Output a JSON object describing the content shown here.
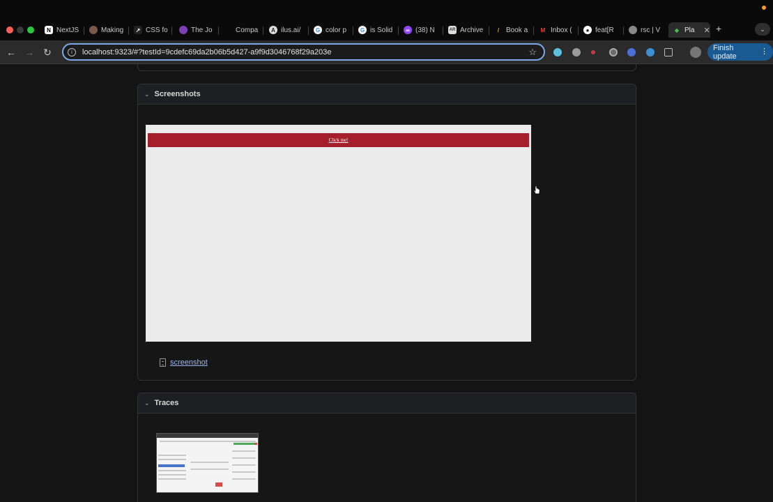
{
  "browser": {
    "tabs": [
      {
        "label": "NextJS",
        "icon": "notion-icon"
      },
      {
        "label": "Making",
        "icon": "avatar-icon"
      },
      {
        "label": "CSS fo",
        "icon": "arrow-icon"
      },
      {
        "label": "The Jo",
        "icon": "circle-icon"
      },
      {
        "label": "Compa",
        "icon": "blank-icon"
      },
      {
        "label": "ilus.ai/",
        "icon": "ilus-icon"
      },
      {
        "label": "color p",
        "icon": "google-icon"
      },
      {
        "label": "is Solid",
        "icon": "google-icon"
      },
      {
        "label": "(38) N",
        "icon": "twitch-icon"
      },
      {
        "label": "Archive",
        "icon": "archive-icon"
      },
      {
        "label": "Book a",
        "icon": "pen-icon"
      },
      {
        "label": "Inbox (",
        "icon": "gmail-icon"
      },
      {
        "label": "feat[R",
        "icon": "github-icon"
      },
      {
        "label": "rsc | V",
        "icon": "globe-icon"
      },
      {
        "label": "Pla",
        "icon": "playwright-icon"
      }
    ],
    "address_bar": {
      "url": "localhost:9323/#?testId=9cdefc69da2b06b5d427-a9f9d3046768f29a203e"
    },
    "finish_update_label": "Finish update"
  },
  "report": {
    "screenshots_section": {
      "title": "Screenshots",
      "button_label": "Click me!",
      "attachment_label": "screenshot"
    },
    "traces_section": {
      "title": "Traces"
    }
  },
  "colors": {
    "accent_button": "#a51e2c",
    "link": "#9ab4f0",
    "update_button": "#1a5a93"
  }
}
